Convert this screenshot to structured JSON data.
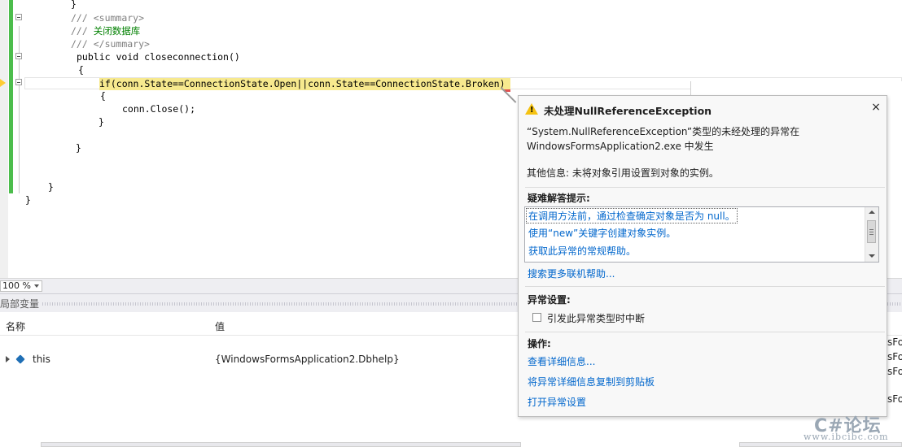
{
  "editor": {
    "lines": {
      "brace_close_inner": "}",
      "summary_open": "/// <summary>",
      "summary_slash": "///",
      "summary_tag_open": "<summary>",
      "summary_text_slash": "///",
      "summary_text": "关闭数据库",
      "summary_end_slash": "///",
      "summary_tag_close": "</summary>",
      "kw_public": "public",
      "kw_void": "void",
      "method_name": "closeconnection()",
      "brace_open": "{",
      "if_stmt": "if(conn.State==ConnectionState.Open||conn.State==ConnectionState.Broken)",
      "brace_open2": "{",
      "close_call": "conn.Close();",
      "brace_close2": "}",
      "brace_close3": "}",
      "brace_close4": "}",
      "brace_close5": "}"
    },
    "zoom": "100 %"
  },
  "locals": {
    "title": "局部变量",
    "col_name": "名称",
    "col_value": "值",
    "rows": [
      {
        "name": "this",
        "value": "{WindowsFormsApplication2.Dbhelp}"
      }
    ],
    "right_snips": [
      "sFor",
      "sFor",
      "sFor",
      "sFor"
    ]
  },
  "exception": {
    "title": "未处理NullReferenceException",
    "message_line1": "“System.NullReferenceException”类型的未经处理的异常在",
    "message_line2": "WindowsFormsApplication2.exe 中发生",
    "extra_info": "其他信息: 未将对象引用设置到对象的实例。",
    "tips_header": "疑难解答提示:",
    "tips": [
      "在调用方法前，通过检查确定对象是否为 null。",
      "使用“new”关键字创建对象实例。",
      "获取此异常的常规帮助。"
    ],
    "search_more": "搜索更多联机帮助...",
    "settings_header": "异常设置:",
    "break_checkbox_label": "引发此异常类型时中断",
    "break_checked": false,
    "actions_header": "操作:",
    "actions": [
      "查看详细信息...",
      "将异常详细信息复制到剪贴板",
      "打开异常设置"
    ],
    "warning_color": "#f5c211",
    "link_color": "#0066cc"
  },
  "watermark": {
    "logo": "C#论坛",
    "url": "www.ibcibc.com"
  },
  "colors": {
    "highlight_statement": "#f7e98e",
    "change_bar": "#4cbd4c",
    "comment": "#008000",
    "keyword": "#0000ff"
  }
}
